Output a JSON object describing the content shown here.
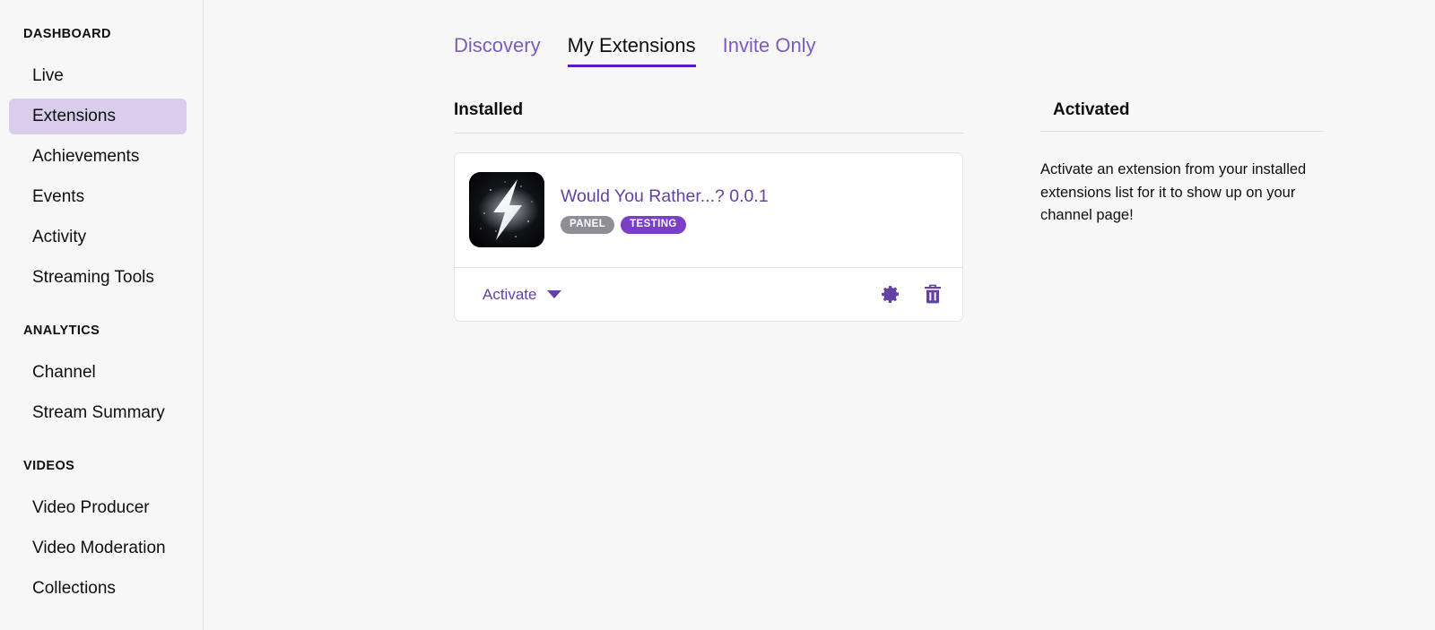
{
  "sidebar": {
    "sections": [
      {
        "title": "DASHBOARD",
        "items": [
          {
            "label": "Live",
            "active": false
          },
          {
            "label": "Extensions",
            "active": true
          },
          {
            "label": "Achievements",
            "active": false
          },
          {
            "label": "Events",
            "active": false
          },
          {
            "label": "Activity",
            "active": false
          },
          {
            "label": "Streaming Tools",
            "active": false
          }
        ]
      },
      {
        "title": "ANALYTICS",
        "items": [
          {
            "label": "Channel",
            "active": false
          },
          {
            "label": "Stream Summary",
            "active": false
          }
        ]
      },
      {
        "title": "VIDEOS",
        "items": [
          {
            "label": "Video Producer",
            "active": false
          },
          {
            "label": "Video Moderation",
            "active": false
          },
          {
            "label": "Collections",
            "active": false
          }
        ]
      }
    ]
  },
  "tabs": [
    {
      "label": "Discovery",
      "active": false
    },
    {
      "label": "My Extensions",
      "active": true
    },
    {
      "label": "Invite Only",
      "active": false
    }
  ],
  "installed": {
    "heading": "Installed",
    "extensions": [
      {
        "title": "Would You Rather...? 0.0.1",
        "badges": [
          {
            "label": "PANEL",
            "style": "gray"
          },
          {
            "label": "TESTING",
            "style": "purple"
          }
        ],
        "icon": "lightning-bolt-icon",
        "activate_label": "Activate",
        "settings_icon": "gear-icon",
        "delete_icon": "trash-icon"
      }
    ]
  },
  "activated": {
    "heading": "Activated",
    "empty_message": "Activate an extension from your installed extensions list for it to show up on your channel page!"
  },
  "colors": {
    "accent": "#5c16c5",
    "link": "#6441a5",
    "active_nav_bg": "#d9cdeb",
    "badge_gray": "#8e8e97",
    "badge_purple": "#7a3fc6",
    "page_bg": "#f7f7f8"
  }
}
